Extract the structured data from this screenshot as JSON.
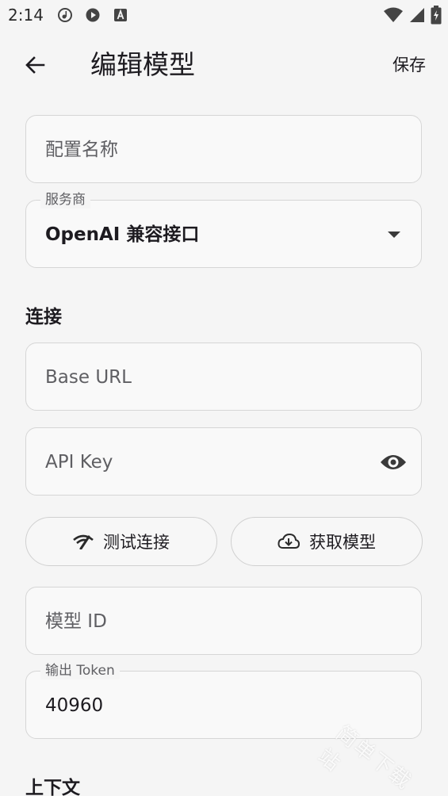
{
  "status_bar": {
    "time": "2:14",
    "icons": [
      "music-notification-icon",
      "play-notification-icon",
      "a-notification-icon"
    ],
    "right_icons": [
      "wifi-icon",
      "signal-icon",
      "battery-icon"
    ]
  },
  "app_bar": {
    "title": "编辑模型",
    "save_label": "保存"
  },
  "form": {
    "config_name": {
      "placeholder": "配置名称"
    },
    "provider": {
      "label": "服务商",
      "value": "OpenAI 兼容接口"
    },
    "connection_header": "连接",
    "base_url": {
      "placeholder": "Base URL"
    },
    "api_key": {
      "placeholder": "API Key"
    },
    "test_connection_label": "测试连接",
    "fetch_models_label": "获取模型",
    "model_id": {
      "placeholder": "模型 ID"
    },
    "output_token": {
      "label": "输出 Token",
      "value": "40960"
    },
    "context_header": "上下文"
  },
  "watermark": "简单下载站",
  "colors": {
    "background": "#f5f5f5",
    "border": "#d6d6d6",
    "text": "#1d1b20",
    "muted": "#5f5f63"
  }
}
